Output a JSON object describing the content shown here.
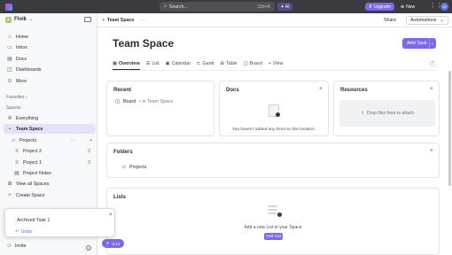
{
  "topbar": {
    "search_placeholder": "Search...",
    "search_shortcut": "Ctrl+K",
    "ai_label": "AI",
    "upgrade_label": "Upgrade",
    "new_label": "New",
    "avatar_initials": "DI"
  },
  "sidebar": {
    "workspace_name": "Floik",
    "workspace_initial": "F",
    "nav": [
      {
        "label": "Home",
        "icon": "home-icon"
      },
      {
        "label": "Inbox",
        "icon": "inbox-icon"
      },
      {
        "label": "Docs",
        "icon": "docs-icon"
      },
      {
        "label": "Dashboards",
        "icon": "dashboards-icon"
      },
      {
        "label": "More",
        "icon": "more-icon"
      }
    ],
    "favorites_label": "Favorites",
    "spaces_label": "Spaces",
    "spaces": [
      {
        "label": "Everything"
      },
      {
        "label": "Team Space"
      },
      {
        "label": "Projects"
      },
      {
        "label": "Project 2",
        "count": "2"
      },
      {
        "label": "Project 1",
        "count": "3"
      },
      {
        "label": "Project Notes"
      },
      {
        "label": "View all Spaces"
      },
      {
        "label": "Create Space"
      }
    ],
    "invite_label": "Invite",
    "help_glyph": "?"
  },
  "header": {
    "breadcrumb": "Team Space",
    "share_label": "Share",
    "automations_label": "Automations"
  },
  "page": {
    "title": "Team Space",
    "add_task_label": "Add Task",
    "tabs": [
      {
        "label": "Overview"
      },
      {
        "label": "List"
      },
      {
        "label": "Calendar"
      },
      {
        "label": "Gantt"
      },
      {
        "label": "Table"
      },
      {
        "label": "Board"
      },
      {
        "label": "View"
      }
    ]
  },
  "recent": {
    "title": "Recent",
    "item_name": "Board",
    "item_location": "• in Team Space"
  },
  "docs": {
    "title": "Docs",
    "empty_text": "You haven't added any Docs to this location."
  },
  "resources": {
    "title": "Resources",
    "drop_text": "Drop files here to attach"
  },
  "folders": {
    "title": "Folders",
    "items": [
      "Projects"
    ]
  },
  "lists": {
    "title": "Lists",
    "empty_text": "Add a new List to your Space",
    "add_label": "Add List"
  },
  "toast": {
    "message": "Archived Task 1",
    "undo_label": "Undo"
  },
  "record_widget": {
    "label": "0:14"
  },
  "colors": {
    "accent": "#7b68ee",
    "topbar": "#3a3b40",
    "sidebar_selected": "#e4e1fb"
  }
}
